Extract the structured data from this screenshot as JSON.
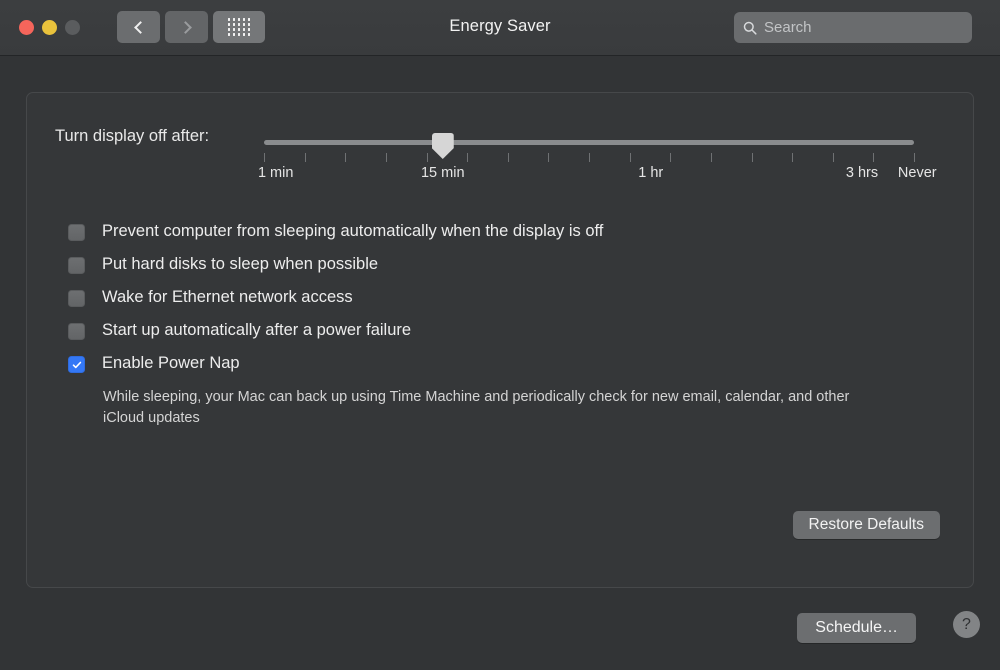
{
  "window": {
    "title": "Energy Saver",
    "traffic_lights": [
      {
        "name": "close",
        "color": "#f5655b"
      },
      {
        "name": "minimize",
        "color": "#e9c23c"
      },
      {
        "name": "zoom",
        "color": "#5a5c5e"
      }
    ]
  },
  "toolbar": {
    "back_icon": "chevron-left-icon",
    "forward_icon": "chevron-right-icon",
    "show_all_icon": "grid-icon",
    "search": {
      "icon": "search-icon",
      "placeholder": "Search",
      "value": ""
    }
  },
  "slider": {
    "label": "Turn display off after:",
    "value_label": "15 min",
    "thumb_position_percent": 27.5,
    "tick_count": 17,
    "tick_labels": [
      {
        "text": "1 min",
        "position_percent": 1.8
      },
      {
        "text": "15 min",
        "position_percent": 27.5
      },
      {
        "text": "1 hr",
        "position_percent": 59.5
      },
      {
        "text": "3 hrs",
        "position_percent": 92.0
      },
      {
        "text": "Never",
        "position_percent": 100.5
      }
    ]
  },
  "checkboxes": [
    {
      "name": "prevent-computer-sleeping",
      "label": "Prevent computer from sleeping automatically when the display is off",
      "checked": false
    },
    {
      "name": "put-hard-disks-to-sleep",
      "label": "Put hard disks to sleep when possible",
      "checked": false
    },
    {
      "name": "wake-for-ethernet",
      "label": "Wake for Ethernet network access",
      "checked": false
    },
    {
      "name": "start-up-after-power-failure",
      "label": "Start up automatically after a power failure",
      "checked": false
    },
    {
      "name": "enable-power-nap",
      "label": "Enable Power Nap",
      "checked": true
    }
  ],
  "power_nap_description": "While sleeping, your Mac can back up using Time Machine and periodically check for new email, calendar, and other iCloud updates",
  "buttons": {
    "restore_defaults": "Restore Defaults",
    "schedule": "Schedule…",
    "help": "?"
  },
  "colors": {
    "window_background": "#323436",
    "titlebar": "#3a3c3e",
    "pane_background": "#353739",
    "pane_border": "#46484a",
    "accent_checked": "#3478f6",
    "control_gray": "#6c6e70",
    "text_primary": "#ededed",
    "text_secondary": "#d4d4d4"
  }
}
